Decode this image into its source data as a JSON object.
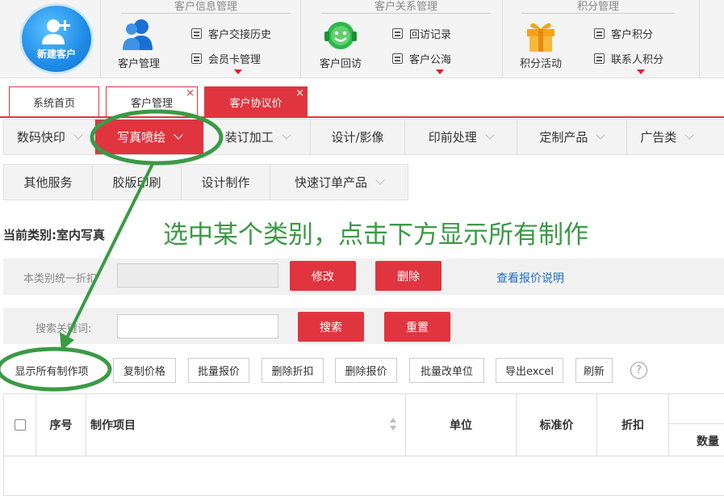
{
  "ribbon": {
    "new_customer": "新建客户",
    "groups": [
      {
        "title": "客户信息管理",
        "big": "客户管理",
        "items": [
          "客户交接历史",
          "会员卡管理"
        ]
      },
      {
        "title": "客户关系管理",
        "big": "客户回访",
        "items": [
          "回访记录",
          "客户公海"
        ]
      },
      {
        "title": "积分管理",
        "big": "积分活动",
        "items": [
          "客户积分",
          "联系人积分"
        ]
      }
    ]
  },
  "tabs": [
    {
      "label": "系统首页"
    },
    {
      "label": "客户管理"
    },
    {
      "label": "客户协议价"
    }
  ],
  "tab_close_glyph": "×",
  "categories_row1": [
    {
      "label": "数码快印"
    },
    {
      "label": "写真喷绘"
    },
    {
      "label": "装订加工"
    },
    {
      "label": "设计/影像"
    },
    {
      "label": "印前处理"
    },
    {
      "label": "定制产品"
    },
    {
      "label": "广告类"
    }
  ],
  "categories_row2": [
    {
      "label": "其他服务"
    },
    {
      "label": "胶版印刷"
    },
    {
      "label": "设计制作"
    },
    {
      "label": "快速订单产品"
    }
  ],
  "current_category": "当前类别:室内写真",
  "instruction": "选中某个类别，点击下方显示所有制作",
  "discount_row": {
    "label": "本类别统一折扣",
    "value": "",
    "modify": "修改",
    "delete": "删除",
    "link": "查看报价说明"
  },
  "search_row": {
    "label": "搜索关键词:",
    "value": "",
    "search": "搜索",
    "reset": "重置"
  },
  "toolbar": [
    "显示所有制作项",
    "复制价格",
    "批量报价",
    "删除折扣",
    "删除报价",
    "批量改单位",
    "导出excel",
    "刷新"
  ],
  "help_glyph": "?",
  "table": {
    "columns": [
      "序号",
      "制作项目",
      "单位",
      "标准价",
      "折扣",
      "数量"
    ]
  },
  "colors": {
    "accent_red": "#e0353f",
    "annotation_green": "#3a9a45",
    "link_blue": "#1f6fbf"
  }
}
